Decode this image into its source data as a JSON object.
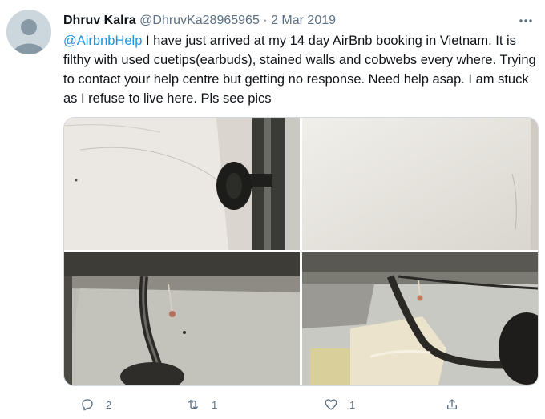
{
  "tweet": {
    "author_name": "Dhruv Kalra",
    "author_handle": "@DhruvKa28965965",
    "separator": "·",
    "date": "2 Mar 2019",
    "mention": "@AirbnbHelp",
    "text": " I have just arrived at my 14 day AirBnb booking in Vietnam. It is filthy with used cuetips(earbuds), stained walls and cobwebs every where. Trying to contact your help centre but getting no response. Need help asap. I am stuck as I refuse to live here. Pls see pics"
  },
  "actions": {
    "reply_count": "2",
    "retweet_count": "1",
    "like_count": "1"
  },
  "icons": {
    "avatar": "default-avatar-icon",
    "more": "more-dots-icon",
    "reply": "reply-icon",
    "retweet": "retweet-icon",
    "like": "heart-icon",
    "share": "share-icon"
  },
  "colors": {
    "link": "#1b95e0",
    "secondary_text": "#5b7083",
    "avatar_bg": "#ccd6dd"
  }
}
